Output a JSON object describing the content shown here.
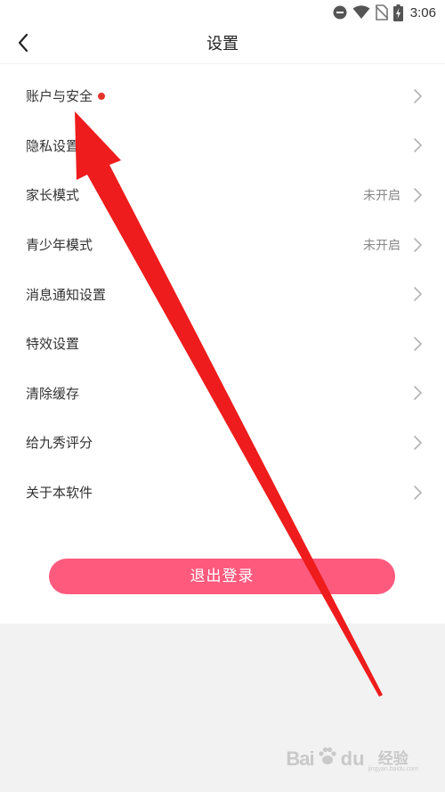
{
  "status_bar": {
    "time": "3:06",
    "icons": [
      "do-not-disturb-icon",
      "wifi-icon",
      "no-sim-icon",
      "battery-charging-icon"
    ]
  },
  "header": {
    "title": "设置",
    "back_icon": "chevron-left-icon"
  },
  "settings": {
    "items": [
      {
        "label": "账户与安全",
        "status": "",
        "has_dot": true
      },
      {
        "label": "隐私设置",
        "status": ""
      },
      {
        "label": "家长模式",
        "status": "未开启"
      },
      {
        "label": "青少年模式",
        "status": "未开启"
      },
      {
        "label": "消息通知设置",
        "status": ""
      },
      {
        "label": "特效设置",
        "status": ""
      },
      {
        "label": "清除缓存",
        "status": ""
      },
      {
        "label": "给九秀评分",
        "status": ""
      },
      {
        "label": "关于本软件",
        "status": ""
      }
    ]
  },
  "logout": {
    "label": "退出登录"
  },
  "colors": {
    "accent": "#fd5a7e",
    "notification_dot": "#e5332a",
    "annotation_arrow": "#ee1c1c",
    "page_background": "#f2f2f2"
  },
  "watermark": {
    "brand_bai": "Bai",
    "brand_du": "du",
    "text_cn": "经验",
    "text_sub": "jingyan.baidu.com"
  }
}
